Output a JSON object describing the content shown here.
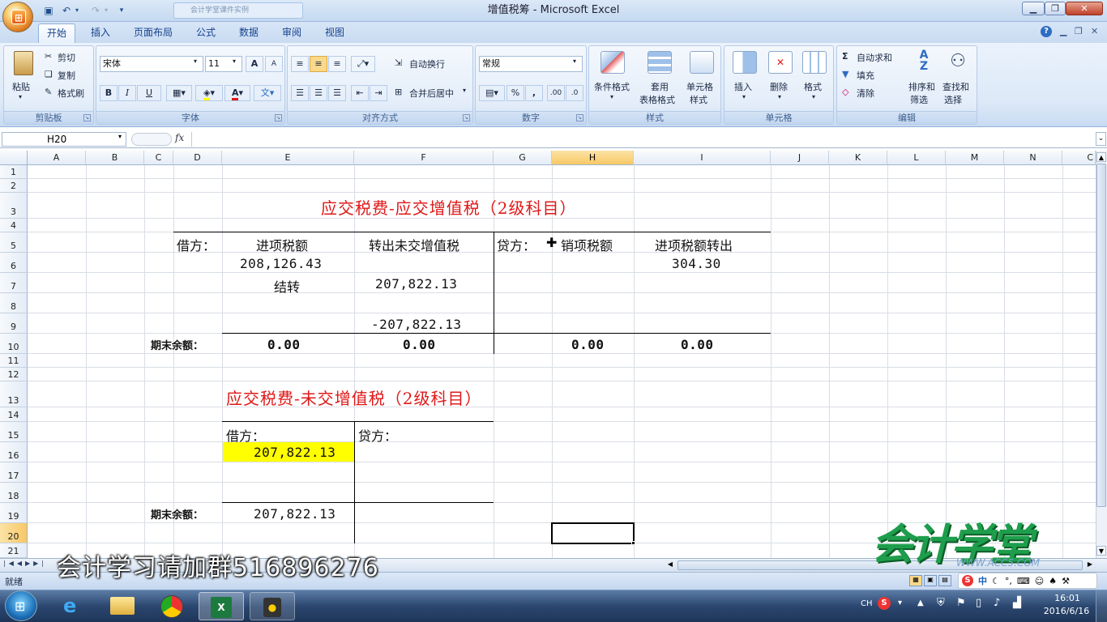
{
  "window": {
    "title": "增值税筹 - Microsoft Excel",
    "taskwin": "会计学堂课件实例"
  },
  "tabs": [
    "开始",
    "插入",
    "页面布局",
    "公式",
    "数据",
    "审阅",
    "视图"
  ],
  "ribbon": {
    "clipboard": {
      "paste": "粘贴",
      "cut": "剪切",
      "copy": "复制",
      "format_painter": "格式刷",
      "label": "剪贴板"
    },
    "font": {
      "name": "宋体",
      "size": "11",
      "label": "字体",
      "bold": "B",
      "italic": "I",
      "underline": "U",
      "grow": "A",
      "shrink": "A",
      "color": "A",
      "phonetic": "文"
    },
    "alignment": {
      "wrap": "自动换行",
      "merge": "合并后居中",
      "label": "对齐方式"
    },
    "number": {
      "format": "常规",
      "percent": "%",
      "comma": ",",
      "label": "数字"
    },
    "styles": {
      "conditional": "条件格式",
      "table_1": "套用",
      "table_2": "表格格式",
      "cell_1": "单元格",
      "cell_2": "样式",
      "label": "样式"
    },
    "cells": {
      "insert": "插入",
      "delete": "删除",
      "format": "格式",
      "label": "单元格"
    },
    "editing": {
      "autosum": "自动求和",
      "fill": "填充",
      "clear": "清除",
      "sort_1": "排序和",
      "sort_2": "筛选",
      "find_1": "查找和",
      "find_2": "选择",
      "label": "编辑"
    }
  },
  "formula_bar": {
    "name_box": "H20",
    "fx": "fx",
    "value": ""
  },
  "columns": [
    "A",
    "B",
    "C",
    "D",
    "E",
    "F",
    "G",
    "H",
    "I",
    "J",
    "K",
    "L",
    "M",
    "N",
    "C"
  ],
  "rows": [
    "1",
    "2",
    "3",
    "4",
    "5",
    "6",
    "7",
    "8",
    "9",
    "10",
    "11",
    "12",
    "13",
    "14",
    "15",
    "16",
    "17",
    "18",
    "19",
    "20",
    "21"
  ],
  "sheet": {
    "title1": "应交税费-应交增值税（2级科目）",
    "debit_label": "借方：",
    "input_tax": "进项税额",
    "transfer_out_unpaid": "转出未交增值税",
    "credit_label": "贷方：",
    "output_tax": "销项税额",
    "input_tax_transfer_out": "进项税额转出",
    "e6": "208,126.43",
    "i6": "304.30",
    "e7": "结转",
    "f7": "207,822.13",
    "f9": "-207,822.13",
    "ending_balance": "期末余额：",
    "e10": "0.00",
    "f10": "0.00",
    "h10": "0.00",
    "i10": "0.00",
    "title2": "应交税费-未交增值税（2级科目）",
    "debit2": "借方：",
    "credit2": "贷方：",
    "e16": "207,822.13",
    "ending_balance2": "期末余额：",
    "e19": "207,822.13"
  },
  "status": {
    "ready": "就绪"
  },
  "watermark": "会计学习请加群516896276",
  "logo": {
    "text": "会计学堂",
    "url": "WWW.ACC5.COM"
  },
  "taskbar": {
    "lang": "CH",
    "time": "16:01",
    "date": "2016/6/16",
    "ime": "中"
  },
  "colors": {
    "title_red": "#e01818",
    "highlight": "#ffff00",
    "selected_header": "#f8c865"
  }
}
